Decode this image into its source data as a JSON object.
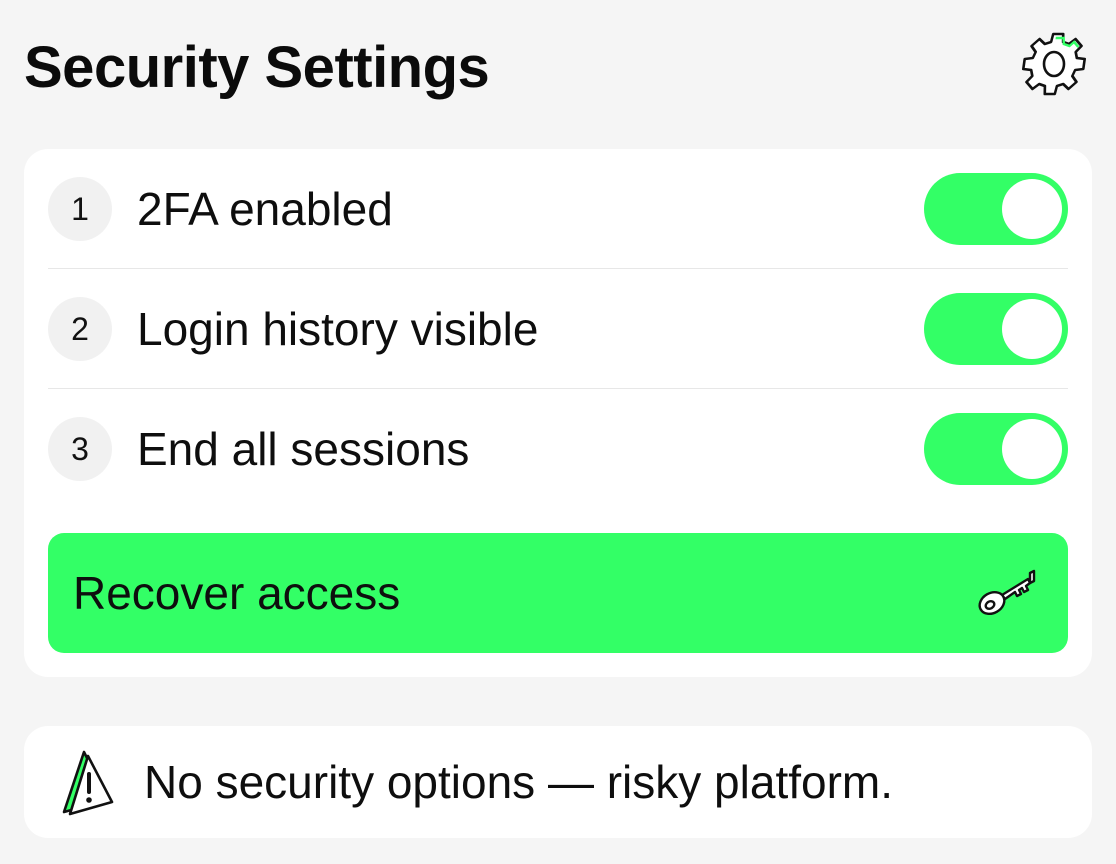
{
  "header": {
    "title": "Security Settings",
    "settings_icon": "gear-icon"
  },
  "settings": {
    "items": [
      {
        "number": "1",
        "label": "2FA enabled",
        "enabled": true
      },
      {
        "number": "2",
        "label": "Login history visible",
        "enabled": true
      },
      {
        "number": "3",
        "label": "End all sessions",
        "enabled": true
      }
    ],
    "recover_label": "Recover access",
    "recover_icon": "key-icon"
  },
  "notice": {
    "text": "No security options — risky platform.",
    "icon": "warning-icon"
  },
  "colors": {
    "accent": "#33ff66",
    "background": "#f5f5f5",
    "card": "#ffffff"
  }
}
